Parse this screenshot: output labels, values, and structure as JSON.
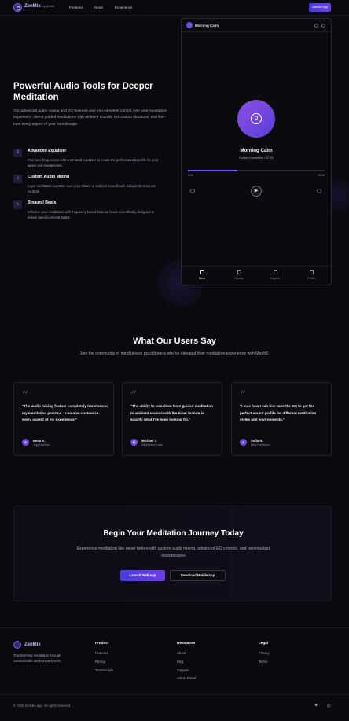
{
  "nav": {
    "brand": "ZenMix",
    "brand_sub": "by Medit8",
    "links": [
      "Features",
      "About",
      "Experience"
    ],
    "launch": "Launch App"
  },
  "hero": {
    "title": "Powerful Audio Tools for Deeper Meditation",
    "description": "Our advanced audio mixing and EQ features give you complete control over your meditation experience. Blend guided meditations with ambient sounds, set custom durations, and fine-tune every aspect of your soundscape.",
    "features": [
      {
        "icon": "equalizer-icon",
        "title": "Advanced Equalizer",
        "desc": "Fine-tune frequencies with a 10-band equalizer to create the perfect sound profile for your space and headphones."
      },
      {
        "icon": "music-note-icon",
        "title": "Custom Audio Mixing",
        "desc": "Layer meditation narration over your choice of ambient sounds with independent volume controls."
      },
      {
        "icon": "wave-icon",
        "title": "Binaural Beats",
        "desc": "Enhance your meditation with frequency-based binaural beats scientifically designed to induce specific mental states."
      }
    ]
  },
  "phone": {
    "header_title": "Morning Calm",
    "disc_letter": "D",
    "track_title": "Morning Calm",
    "track_sub": "Guided meditation • 10:00",
    "progress": 0.36,
    "time_start": "0:00",
    "time_end": "10:00",
    "tabs": [
      "Mixer",
      "Sounds",
      "Explore",
      "Profile"
    ],
    "active_tab": "Mixer"
  },
  "testimonials": {
    "title": "What Our Users Say",
    "subtitle": "Join the community of mindfulness practitioners who've elevated their meditation experience with Medit8.",
    "items": [
      {
        "quote": "\"The audio mixing feature completely transformed my meditation practice. I can now customize every aspect of my experience.\"",
        "initial": "S",
        "name": "Beau K.",
        "role": "Yoga Instructor"
      },
      {
        "quote": "\"The ability to transition from guided meditation to ambient sounds with the timer feature is exactly what I've been looking for.\"",
        "initial": "M",
        "name": "Michael T.",
        "role": "Mindfulness Coach"
      },
      {
        "quote": "\"I love how I can fine-tune the EQ to get the perfect sound profile for different meditation styles and environments.\"",
        "initial": "S",
        "name": "Sofia R.",
        "role": "Daily Practitioner"
      }
    ]
  },
  "cta": {
    "title": "Begin Your Meditation Journey Today",
    "description": "Experience meditation like never before with custom audio mixing, advanced EQ controls, and personalized soundscapes.",
    "primary": "Launch Web App",
    "secondary": "Download Mobile App"
  },
  "footer": {
    "brand": "ZenMix",
    "tagline": "Transforming meditation through customizable audio experiences.",
    "columns": [
      {
        "title": "Product",
        "links": [
          "Features",
          "Pricing",
          "Testimonials"
        ]
      },
      {
        "title": "Resources",
        "links": [
          "About",
          "Blog",
          "Support",
          "Admin Portal"
        ]
      },
      {
        "title": "Legal",
        "links": [
          "Privacy",
          "Terms"
        ]
      }
    ],
    "copyright": "© 2025 ZenMix.app. All rights reserved.",
    "social": [
      "twitter-icon",
      "instagram-icon"
    ]
  },
  "colors": {
    "accent": "#6f4ce0",
    "background": "#0a090d"
  }
}
